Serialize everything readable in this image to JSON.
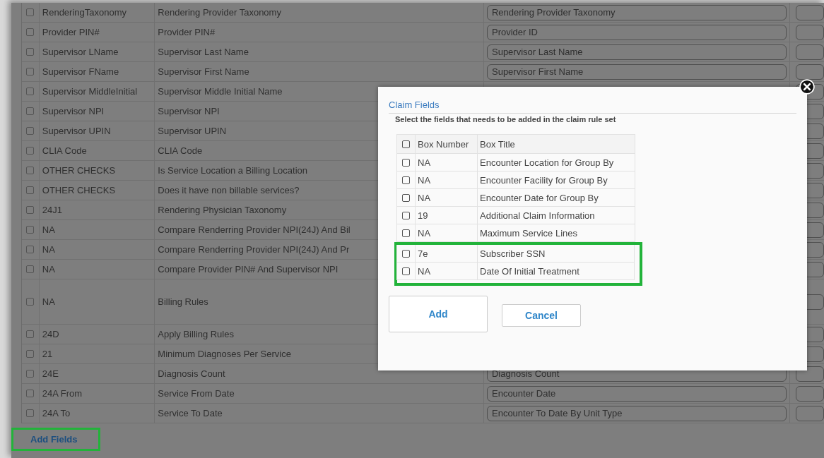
{
  "table": {
    "rows": [
      {
        "kind": "standard",
        "checked": false,
        "code": "RenderingTaxonomy",
        "title": "Rendering Provider Taxonomy",
        "field": "Rendering Provider Taxonomy"
      },
      {
        "kind": "standard",
        "checked": false,
        "code": "Provider PIN#",
        "title": "Provider PIN#",
        "field": "Provider ID"
      },
      {
        "kind": "standard",
        "checked": false,
        "code": "Supervisor LName",
        "title": "Supervisor Last Name",
        "field": "Supervisor Last Name"
      },
      {
        "kind": "standard",
        "checked": false,
        "code": "Supervisor FName",
        "title": "Supervisor First Name",
        "field": "Supervisor First Name"
      },
      {
        "kind": "standard",
        "checked": false,
        "code": "Supervisor MiddleInitial",
        "title": "Supervisor Middle Initial Name"
      },
      {
        "kind": "standard",
        "checked": false,
        "code": "Supervisor NPI",
        "title": "Supervisor NPI"
      },
      {
        "kind": "standard",
        "checked": false,
        "code": "Supervisor UPIN",
        "title": "Supervisor UPIN"
      },
      {
        "kind": "standard",
        "checked": false,
        "code": "CLIA Code",
        "title": "CLIA Code"
      },
      {
        "kind": "standard",
        "checked": false,
        "code": "OTHER CHECKS",
        "title": "Is Service Location a Billing Location"
      },
      {
        "kind": "standard",
        "checked": false,
        "code": "OTHER CHECKS",
        "title": "Does it have non billable services?"
      },
      {
        "kind": "standard",
        "checked": false,
        "code": "24J1",
        "title": "Rendering Physician Taxonomy"
      },
      {
        "kind": "standard",
        "checked": false,
        "code": "NA",
        "title": "Compare Renderring Provider NPI(24J) And Bil"
      },
      {
        "kind": "standard",
        "checked": false,
        "code": "NA",
        "title": "Compare Renderring Provider NPI(24J) And Pr"
      },
      {
        "kind": "standard",
        "checked": false,
        "code": "NA",
        "title": "Compare Provider PIN# And Supervisor NPI"
      },
      {
        "kind": "tall",
        "checked": false,
        "code": "NA",
        "title": "Billing Rules"
      },
      {
        "kind": "standard",
        "checked": false,
        "code": "24D",
        "title": "Apply Billing Rules"
      },
      {
        "kind": "standard",
        "checked": false,
        "code": "21",
        "title": "Minimum Diagnoses Per Service"
      },
      {
        "kind": "standard",
        "checked": false,
        "code": "24E",
        "title": "Diagnosis Count",
        "field": "Diagnosis Count"
      },
      {
        "kind": "standard",
        "checked": false,
        "code": "24A From",
        "title": "Service From Date",
        "field": "Encounter Date"
      },
      {
        "kind": "standard",
        "checked": false,
        "code": "24A To",
        "title": "Service To Date",
        "field": "Encounter To Date By Unit Type"
      }
    ]
  },
  "add_fields_button": {
    "label": "Add Fields",
    "highlighted": true
  },
  "modal": {
    "title": "Claim Fields",
    "subtitle": "Select the fields that needs to be added in the claim rule set",
    "header": {
      "checked": false,
      "columns": [
        "Box Number",
        "Box Title"
      ]
    },
    "rows": [
      {
        "checked": false,
        "box_number": "NA",
        "box_title": "Encounter Location for Group By",
        "highlighted": false
      },
      {
        "checked": false,
        "box_number": "NA",
        "box_title": "Encounter Facility for Group By",
        "highlighted": false
      },
      {
        "checked": false,
        "box_number": "NA",
        "box_title": "Encounter Date for Group By",
        "highlighted": false
      },
      {
        "checked": false,
        "box_number": "19",
        "box_title": "Additional Claim Information",
        "highlighted": false
      },
      {
        "checked": false,
        "box_number": "NA",
        "box_title": "Maximum Service Lines",
        "highlighted": false
      },
      {
        "checked": false,
        "box_number": "7e",
        "box_title": "Subscriber SSN",
        "highlighted": true
      },
      {
        "checked": false,
        "box_number": "NA",
        "box_title": "Date Of Initial Treatment",
        "highlighted": true
      }
    ],
    "buttons": [
      "Add",
      "Cancel"
    ]
  }
}
